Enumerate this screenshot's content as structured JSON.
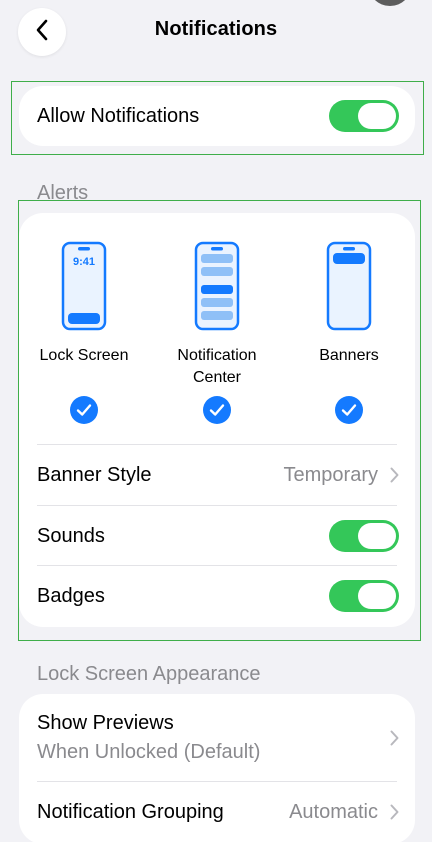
{
  "header": {
    "title": "Notifications",
    "back_icon": "chevron-left-icon"
  },
  "allow": {
    "label": "Allow Notifications",
    "enabled": true
  },
  "alerts": {
    "section_title": "Alerts",
    "styles": [
      {
        "label": "Lock Screen",
        "selected": true,
        "preview_time": "9:41"
      },
      {
        "label": "Notification Center",
        "line1": "Notification",
        "line2": "Center",
        "selected": true
      },
      {
        "label": "Banners",
        "selected": true
      }
    ],
    "banner_style": {
      "label": "Banner Style",
      "value": "Temporary"
    },
    "sounds": {
      "label": "Sounds",
      "enabled": true
    },
    "badges": {
      "label": "Badges",
      "enabled": true
    }
  },
  "lock_screen": {
    "section_title": "Lock Screen Appearance",
    "show_previews": {
      "label": "Show Previews",
      "value": "When Unlocked (Default)"
    },
    "grouping": {
      "label": "Notification Grouping",
      "value": "Automatic"
    }
  },
  "colors": {
    "accent_blue": "#147aff",
    "toggle_green": "#34c759",
    "background": "#f2f2f6",
    "secondary_text": "#8a8a8e"
  }
}
